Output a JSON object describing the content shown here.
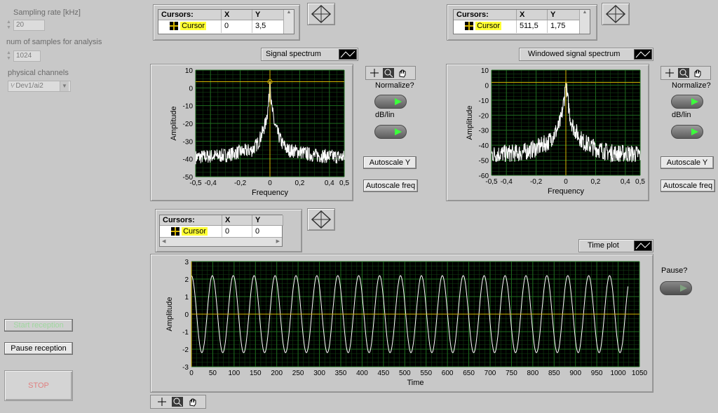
{
  "controls": {
    "sampling_rate_label": "Sampling rate [kHz]",
    "sampling_rate_value": "20",
    "num_samples_label": "num of samples for analysis",
    "num_samples_value": "1024",
    "physical_channels_label": "physical channels",
    "physical_channel_value": "Dev1/ai2",
    "start_reception_label": "Start reception",
    "pause_reception_label": "Pause reception",
    "stop_label": "STOP"
  },
  "spectrum_panel": {
    "cursor_table": {
      "headers": [
        "Cursors:",
        "X",
        "Y"
      ],
      "row": {
        "name": "Cursor",
        "x": "0",
        "y": "3,5"
      }
    },
    "legend_label": "Signal spectrum",
    "normalize_label": "Normalize?",
    "dblin_label": "dB/lin",
    "autoscale_y_label": "Autoscale Y",
    "autoscale_freq_label": "Autoscale freq"
  },
  "windowed_panel": {
    "cursor_table": {
      "headers": [
        "Cursors:",
        "X",
        "Y"
      ],
      "row": {
        "name": "Cursor",
        "x": "511,5",
        "y": "1,75"
      }
    },
    "legend_label": "Windowed signal spectrum",
    "normalize_label": "Normalize?",
    "dblin_label": "dB/lin",
    "autoscale_y_label": "Autoscale Y",
    "autoscale_freq_label": "Autoscale freq"
  },
  "time_panel": {
    "cursor_table": {
      "headers": [
        "Cursors:",
        "X",
        "Y"
      ],
      "row": {
        "name": "Cursor",
        "x": "0",
        "y": "0"
      }
    },
    "legend_label": "Time plot",
    "pause_label": "Pause?"
  },
  "colors": {
    "plot_bg": "#000000",
    "grid": "#1e6b1e",
    "trace": "#ffffff",
    "cursor": "#d4b400",
    "led_on": "#3cff3c",
    "led_off": "#7fa07f",
    "highlight": "#ffff33"
  },
  "chart_data": [
    {
      "type": "line",
      "xlabel": "Frequency",
      "ylabel": "Amplitude",
      "xlim": [
        -0.5,
        0.5
      ],
      "ylim": [
        -50,
        10
      ],
      "xticks": [
        "-0,5",
        "-0,4",
        "-0,2",
        "0",
        "0,2",
        "0,4",
        "0,5"
      ],
      "xtick_values": [
        -0.5,
        -0.4,
        -0.2,
        0,
        0.2,
        0.4,
        0.5
      ],
      "yticks": [
        "10",
        "0",
        "-10",
        "-20",
        "-30",
        "-40",
        "-50"
      ],
      "ytick_values": [
        10,
        0,
        -10,
        -20,
        -30,
        -40,
        -50
      ],
      "cursor": {
        "x": 0,
        "y": 3.5
      },
      "series": [
        {
          "profile": [
            [
              -0.5,
              -39
            ],
            [
              -0.3,
              -38
            ],
            [
              -0.2,
              -36
            ],
            [
              -0.12,
              -35
            ],
            [
              -0.08,
              -31
            ],
            [
              -0.05,
              -25
            ],
            [
              -0.03,
              -20
            ],
            [
              -0.01,
              -10
            ],
            [
              0,
              3.5
            ],
            [
              0.01,
              -10
            ],
            [
              0.03,
              -20
            ],
            [
              0.05,
              -25
            ],
            [
              0.08,
              -31
            ],
            [
              0.12,
              -35
            ],
            [
              0.2,
              -36
            ],
            [
              0.3,
              -38
            ],
            [
              0.5,
              -39
            ]
          ],
          "noise": 4
        }
      ]
    },
    {
      "type": "line",
      "xlabel": "Frequency",
      "ylabel": "Amplitude",
      "xlim": [
        -0.5,
        0.5
      ],
      "ylim": [
        -60,
        10
      ],
      "xticks": [
        "-0,5",
        "-0,4",
        "-0,2",
        "0",
        "0,2",
        "0,4",
        "0,5"
      ],
      "xtick_values": [
        -0.5,
        -0.4,
        -0.2,
        0,
        0.2,
        0.4,
        0.5
      ],
      "yticks": [
        "10",
        "0",
        "-10",
        "-20",
        "-30",
        "-40",
        "-50",
        "-60"
      ],
      "ytick_values": [
        10,
        0,
        -10,
        -20,
        -30,
        -40,
        -50,
        -60
      ],
      "cursor": {
        "x": 511.5,
        "y": 1.75
      },
      "series": [
        {
          "profile": [
            [
              -0.5,
              -46
            ],
            [
              -0.3,
              -45
            ],
            [
              -0.2,
              -42
            ],
            [
              -0.12,
              -38
            ],
            [
              -0.08,
              -33
            ],
            [
              -0.05,
              -28
            ],
            [
              -0.03,
              -22
            ],
            [
              -0.01,
              -8
            ],
            [
              0,
              1.5
            ],
            [
              0.01,
              -8
            ],
            [
              0.03,
              -22
            ],
            [
              0.05,
              -28
            ],
            [
              0.08,
              -33
            ],
            [
              0.12,
              -38
            ],
            [
              0.2,
              -42
            ],
            [
              0.3,
              -45
            ],
            [
              0.5,
              -46
            ]
          ],
          "noise": 6
        }
      ]
    },
    {
      "type": "line",
      "xlabel": "Time",
      "ylabel": "Amplitude",
      "xlim": [
        0,
        1050
      ],
      "ylim": [
        -3,
        3
      ],
      "xticks": [
        "0",
        "50",
        "100",
        "150",
        "200",
        "250",
        "300",
        "350",
        "400",
        "450",
        "500",
        "550",
        "600",
        "650",
        "700",
        "750",
        "800",
        "850",
        "900",
        "950",
        "1000",
        "1050"
      ],
      "xtick_values": [
        0,
        50,
        100,
        150,
        200,
        250,
        300,
        350,
        400,
        450,
        500,
        550,
        600,
        650,
        700,
        750,
        800,
        850,
        900,
        950,
        1000,
        1050
      ],
      "yticks": [
        "3",
        "2",
        "1",
        "0",
        "-1",
        "-2",
        "-3"
      ],
      "ytick_values": [
        3,
        2,
        1,
        0,
        -1,
        -2,
        -3
      ],
      "cursor": {
        "x": 0,
        "y": 0
      },
      "series": [
        {
          "amplitude": 2.2,
          "period": 49,
          "samples": 1024
        }
      ]
    }
  ]
}
